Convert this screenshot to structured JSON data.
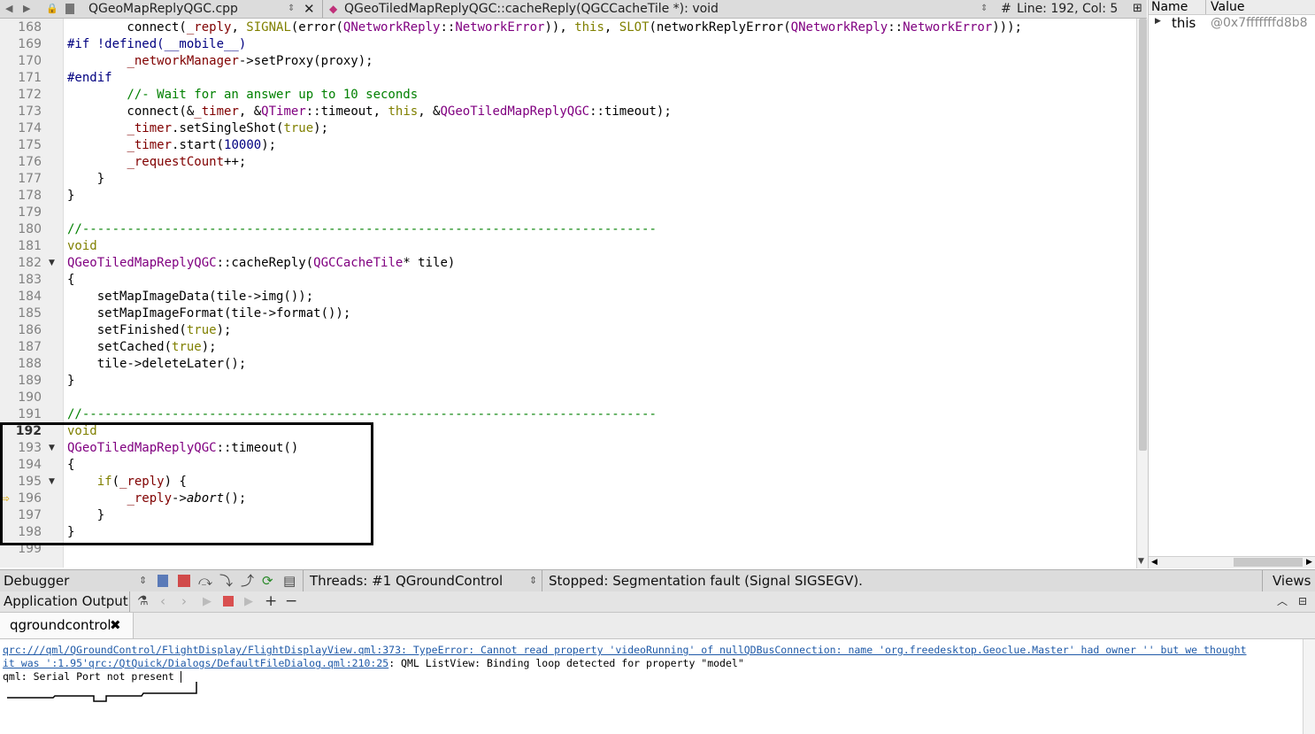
{
  "editor": {
    "file_tab": "QGeoMapReplyQGC.cpp",
    "symbol": "QGeoTiledMapReplyQGC::cacheReply(QGCCacheTile *): void",
    "position": "Line: 192, Col: 5",
    "hash": "#",
    "lines": [
      {
        "n": "168",
        "t": "cl168"
      },
      {
        "n": "169"
      },
      {
        "n": "170"
      },
      {
        "n": "171"
      },
      {
        "n": "172"
      },
      {
        "n": "173"
      },
      {
        "n": "174"
      },
      {
        "n": "175"
      },
      {
        "n": "176"
      },
      {
        "n": "177"
      },
      {
        "n": "178"
      },
      {
        "n": "179"
      },
      {
        "n": "180"
      },
      {
        "n": "181"
      },
      {
        "n": "182"
      },
      {
        "n": "183"
      },
      {
        "n": "184"
      },
      {
        "n": "185"
      },
      {
        "n": "186"
      },
      {
        "n": "187"
      },
      {
        "n": "188"
      },
      {
        "n": "189"
      },
      {
        "n": "190"
      },
      {
        "n": "191"
      },
      {
        "n": "192"
      },
      {
        "n": "193"
      },
      {
        "n": "194"
      },
      {
        "n": "195"
      },
      {
        "n": "196"
      },
      {
        "n": "197"
      },
      {
        "n": "198"
      },
      {
        "n": "199"
      }
    ],
    "code": {
      "l168": [
        "        connect(",
        "_reply",
        ", ",
        "SIGNAL",
        "(error(",
        "QNetworkReply",
        "::",
        "NetworkError",
        ")), ",
        "this",
        ", ",
        "SLOT",
        "(networkReplyError(",
        "QNetworkReply",
        "::",
        "NetworkError",
        ")));"
      ],
      "l169": "#if !defined(__mobile__)",
      "l170": [
        "        ",
        "_networkManager",
        "->setProxy(proxy);"
      ],
      "l171": "#endif",
      "l172": "        //- Wait for an answer up to 10 seconds",
      "l173": [
        "        connect(&",
        "_timer",
        ", &",
        "QTimer",
        "::timeout, ",
        "this",
        ", &",
        "QGeoTiledMapReplyQGC",
        "::timeout);"
      ],
      "l174": [
        "        ",
        "_timer",
        ".setSingleShot(",
        "true",
        ");"
      ],
      "l175": [
        "        ",
        "_timer",
        ".start(",
        "10000",
        ");"
      ],
      "l176": [
        "        ",
        "_requestCount",
        "++;"
      ],
      "l177": "    }",
      "l178": "}",
      "l180": "//-----------------------------------------------------------------------------",
      "l181": "void",
      "l182": [
        "QGeoTiledMapReplyQGC",
        "::cacheReply(",
        "QGCCacheTile",
        "* tile)"
      ],
      "l183": "{",
      "l184": "    setMapImageData(tile->img());",
      "l185": "    setMapImageFormat(tile->format());",
      "l186": [
        "    setFinished(",
        "true",
        ");"
      ],
      "l187": [
        "    setCached(",
        "true",
        ");"
      ],
      "l188": "    tile->deleteLater();",
      "l189": "}",
      "l191": "//-----------------------------------------------------------------------------",
      "l192": "void",
      "l193": [
        "QGeoTiledMapReplyQGC",
        "::timeout()"
      ],
      "l194": "{",
      "l195": [
        "    ",
        "if",
        "(",
        "_reply",
        ") {"
      ],
      "l196": [
        "        ",
        "_reply",
        "->",
        "abort",
        "();"
      ],
      "l197": "    }",
      "l198": "}"
    }
  },
  "locals": {
    "col_name": "Name",
    "col_value": "Value",
    "row_name": "this",
    "row_value": "@0x7fffffffd8b8"
  },
  "debugger_bar": {
    "mode": "Debugger",
    "threads": "Threads: #1 QGroundControl",
    "status": "Stopped: Segmentation fault (Signal SIGSEGV).",
    "views": "Views"
  },
  "output_bar": {
    "title": "Application Output",
    "tab": "qgroundcontrol"
  },
  "output": {
    "line1_link": "qrc:///qml/QGroundControl/FlightDisplay/FlightDisplayView.qml:373: TypeError: Cannot read property 'videoRunning' of nullQDBusConnection: name 'org.freedesktop.Geoclue.Master' had owner '' but we thought",
    "line2_link": "it was ':1.95'qrc:/QtQuick/Dialogs/DefaultFileDialog.qml:210:25",
    "line2_rest": ": QML ListView: Binding loop detected for property \"model\"",
    "line3": "qml: Serial Port not present "
  },
  "colors": {
    "keyword": "#808000",
    "type": "#800080",
    "member": "#800000",
    "comment": "#008000",
    "number": "#000080",
    "link": "#1f5aa8"
  }
}
